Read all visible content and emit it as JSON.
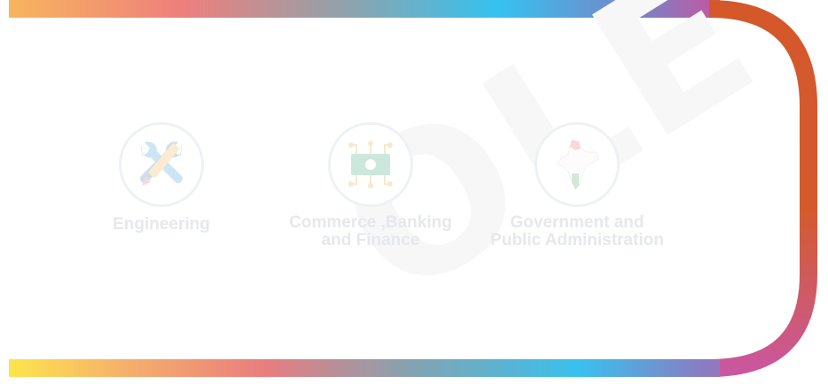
{
  "categories": [
    {
      "label": "Engineering",
      "icon": "tools-icon"
    },
    {
      "label": "Commerce ,Banking\nand Finance",
      "icon": "banknote-icon"
    },
    {
      "label": "Government and\nPublic Administration",
      "icon": "india-map-icon"
    }
  ],
  "watermark": "OLE",
  "colors": {
    "gradient": [
      "#fde64c",
      "#f5a06a",
      "#ea7b80",
      "#7fa2b3",
      "#35c3ef",
      "#c55ba8",
      "#d4582a"
    ],
    "label_text": "#e6e8ec",
    "icon_border": "#eef1f5"
  }
}
